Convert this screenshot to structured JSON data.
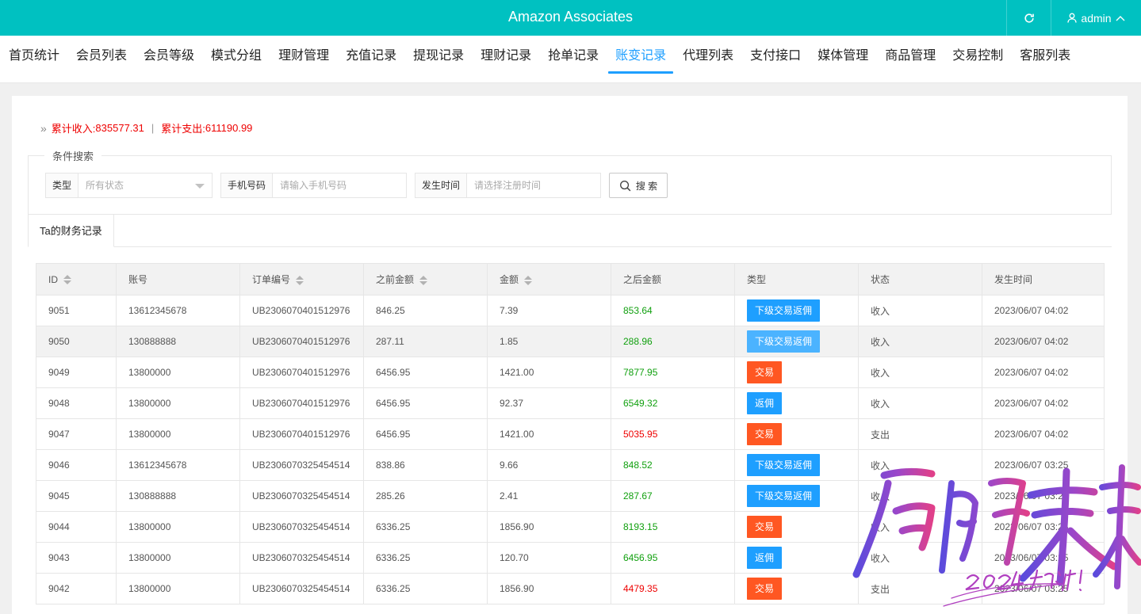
{
  "header": {
    "title": "Amazon Associates",
    "user": "admin"
  },
  "nav": [
    "首页统计",
    "会员列表",
    "会员等级",
    "模式分组",
    "理财管理",
    "充值记录",
    "提现记录",
    "理财记录",
    "抢单记录",
    "账变记录",
    "代理列表",
    "支付接口",
    "媒体管理",
    "商品管理",
    "交易控制",
    "客服列表"
  ],
  "nav_active_index": 9,
  "summary": {
    "income_label": "累计收入:",
    "income": "835577.31",
    "expense_label": "累计支出:",
    "expense": "611190.99"
  },
  "search": {
    "legend": "条件搜索",
    "type_label": "类型",
    "type_value": "所有状态",
    "phone_label": "手机号码",
    "phone_placeholder": "请输入手机号码",
    "time_label": "发生时间",
    "time_placeholder": "请选择注册时间",
    "button": "搜 索"
  },
  "tab": "Ta的财务记录",
  "table": {
    "columns": [
      "ID",
      "账号",
      "订单编号",
      "之前金额",
      "金额",
      "之后金额",
      "类型",
      "状态",
      "发生时间"
    ],
    "rows": [
      {
        "id": "9051",
        "account": "13612345678",
        "order": "UB2306070401512976",
        "before": "846.25",
        "amount": "7.39",
        "after": "853.64",
        "after_color": "green",
        "type": "下级交易返佣",
        "type_color": "blue",
        "status": "收入",
        "time": "2023/06/07 04:02"
      },
      {
        "id": "9050",
        "account": "130888888",
        "order": "UB2306070401512976",
        "before": "287.11",
        "amount": "1.85",
        "after": "288.96",
        "after_color": "green",
        "type": "下级交易返佣",
        "type_color": "blue-light",
        "status": "收入",
        "time": "2023/06/07 04:02"
      },
      {
        "id": "9049",
        "account": "13800000",
        "order": "UB2306070401512976",
        "before": "6456.95",
        "amount": "1421.00",
        "after": "7877.95",
        "after_color": "green",
        "type": "交易",
        "type_color": "orange",
        "status": "收入",
        "time": "2023/06/07 04:02"
      },
      {
        "id": "9048",
        "account": "13800000",
        "order": "UB2306070401512976",
        "before": "6456.95",
        "amount": "92.37",
        "after": "6549.32",
        "after_color": "green",
        "type": "返佣",
        "type_color": "blue",
        "status": "收入",
        "time": "2023/06/07 04:02"
      },
      {
        "id": "9047",
        "account": "13800000",
        "order": "UB2306070401512976",
        "before": "6456.95",
        "amount": "1421.00",
        "after": "5035.95",
        "after_color": "red",
        "type": "交易",
        "type_color": "orange",
        "status": "支出",
        "time": "2023/06/07 04:02"
      },
      {
        "id": "9046",
        "account": "13612345678",
        "order": "UB2306070325454514",
        "before": "838.86",
        "amount": "9.66",
        "after": "848.52",
        "after_color": "green",
        "type": "下级交易返佣",
        "type_color": "blue",
        "status": "收入",
        "time": "2023/06/07 03:25"
      },
      {
        "id": "9045",
        "account": "130888888",
        "order": "UB2306070325454514",
        "before": "285.26",
        "amount": "2.41",
        "after": "287.67",
        "after_color": "green",
        "type": "下级交易返佣",
        "type_color": "blue",
        "status": "收入",
        "time": "2023/06/07 03:25"
      },
      {
        "id": "9044",
        "account": "13800000",
        "order": "UB2306070325454514",
        "before": "6336.25",
        "amount": "1856.90",
        "after": "8193.15",
        "after_color": "green",
        "type": "交易",
        "type_color": "orange",
        "status": "收入",
        "time": "2023/06/07 03:25"
      },
      {
        "id": "9043",
        "account": "13800000",
        "order": "UB2306070325454514",
        "before": "6336.25",
        "amount": "120.70",
        "after": "6456.95",
        "after_color": "green",
        "type": "返佣",
        "type_color": "blue",
        "status": "收入",
        "time": "2023/06/07 03:25"
      },
      {
        "id": "9042",
        "account": "13800000",
        "order": "UB2306070325454514",
        "before": "6336.25",
        "amount": "1856.90",
        "after": "4479.35",
        "after_color": "red",
        "type": "交易",
        "type_color": "orange",
        "status": "支出",
        "time": "2023/06/07 03:25"
      }
    ]
  },
  "watermark": {
    "main": "启航未来",
    "sub": "2024加油!"
  },
  "colors": {
    "header_bg": "#00c1c1",
    "active": "#1e9fff",
    "green": "#11a00f",
    "red": "#ee0000",
    "orange": "#ff5722"
  }
}
